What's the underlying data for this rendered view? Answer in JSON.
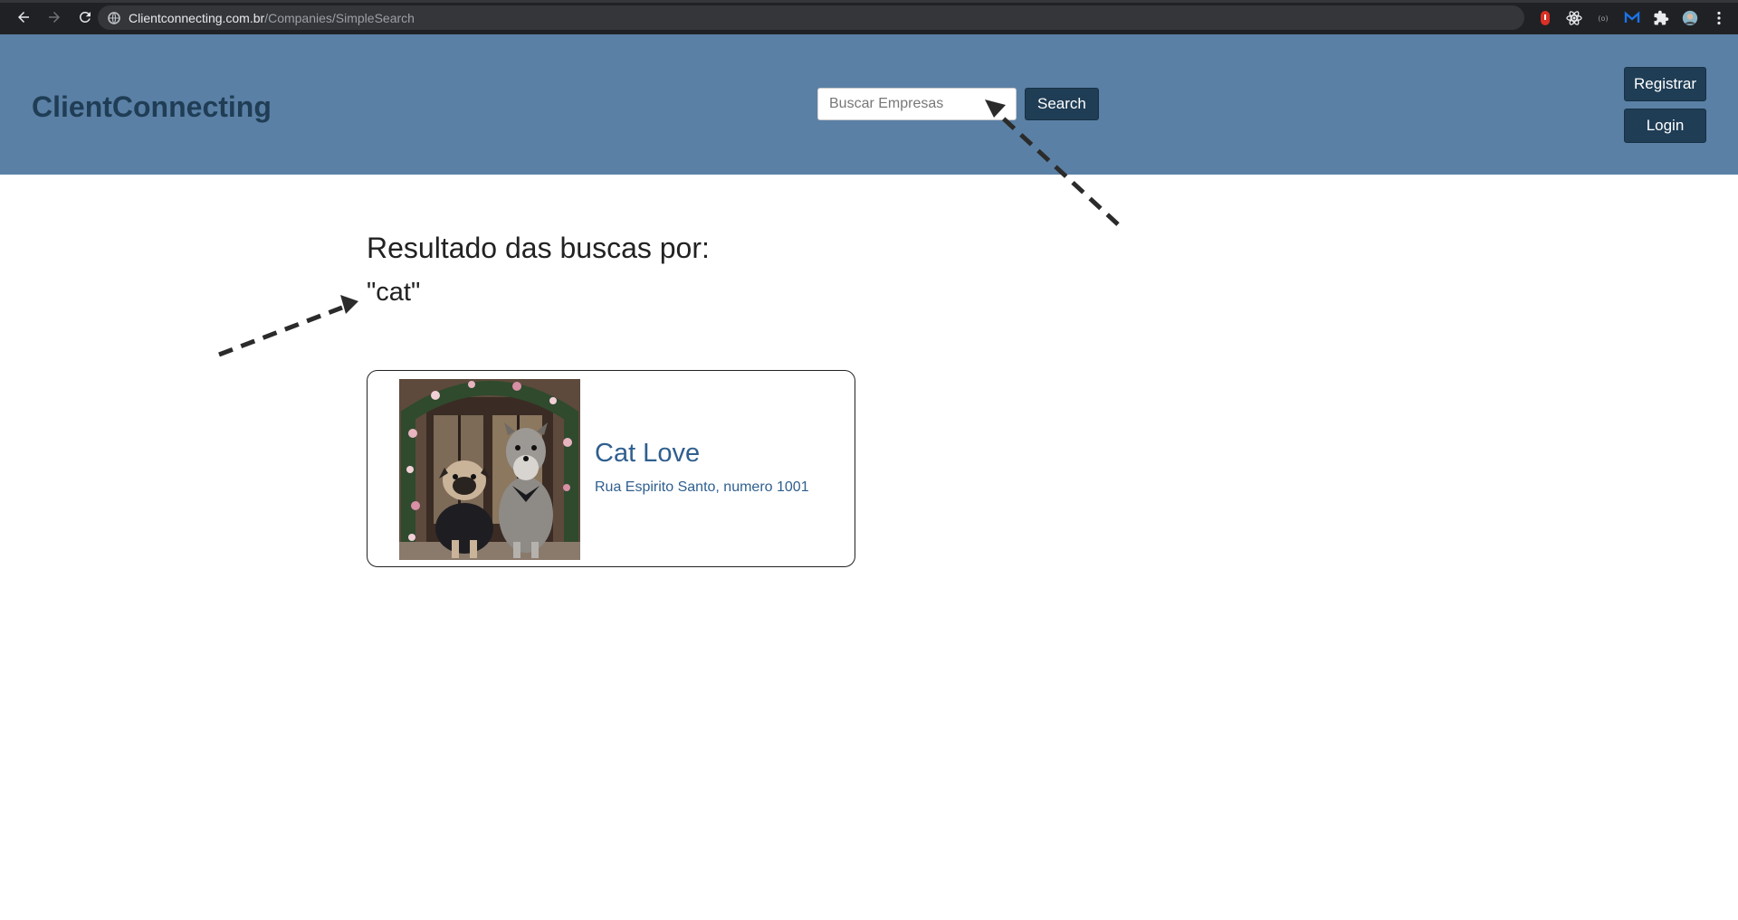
{
  "browser": {
    "url_domain": "Clientconnecting.com.br",
    "url_path": "/Companies/SimpleSearch",
    "icons": [
      "back-arrow-icon",
      "forward-arrow-icon",
      "reload-icon",
      "site-info-icon",
      "extension-icon",
      "profile-avatar-icon",
      "kebab-menu-icon"
    ]
  },
  "header": {
    "brand": "ClientConnecting",
    "search_placeholder": "Buscar Empresas",
    "search_button": "Search",
    "register_button": "Registrar",
    "login_button": "Login",
    "colors": {
      "header_bg": "#5b80a5",
      "brand_text": "#1f3d55",
      "button_bg": "#1f3d55"
    }
  },
  "main": {
    "results_heading": "Resultado das buscas por:",
    "query": "\"cat\"",
    "results": [
      {
        "title": "Cat Love",
        "address": "Rua Espirito Santo, numero 1001"
      }
    ]
  }
}
